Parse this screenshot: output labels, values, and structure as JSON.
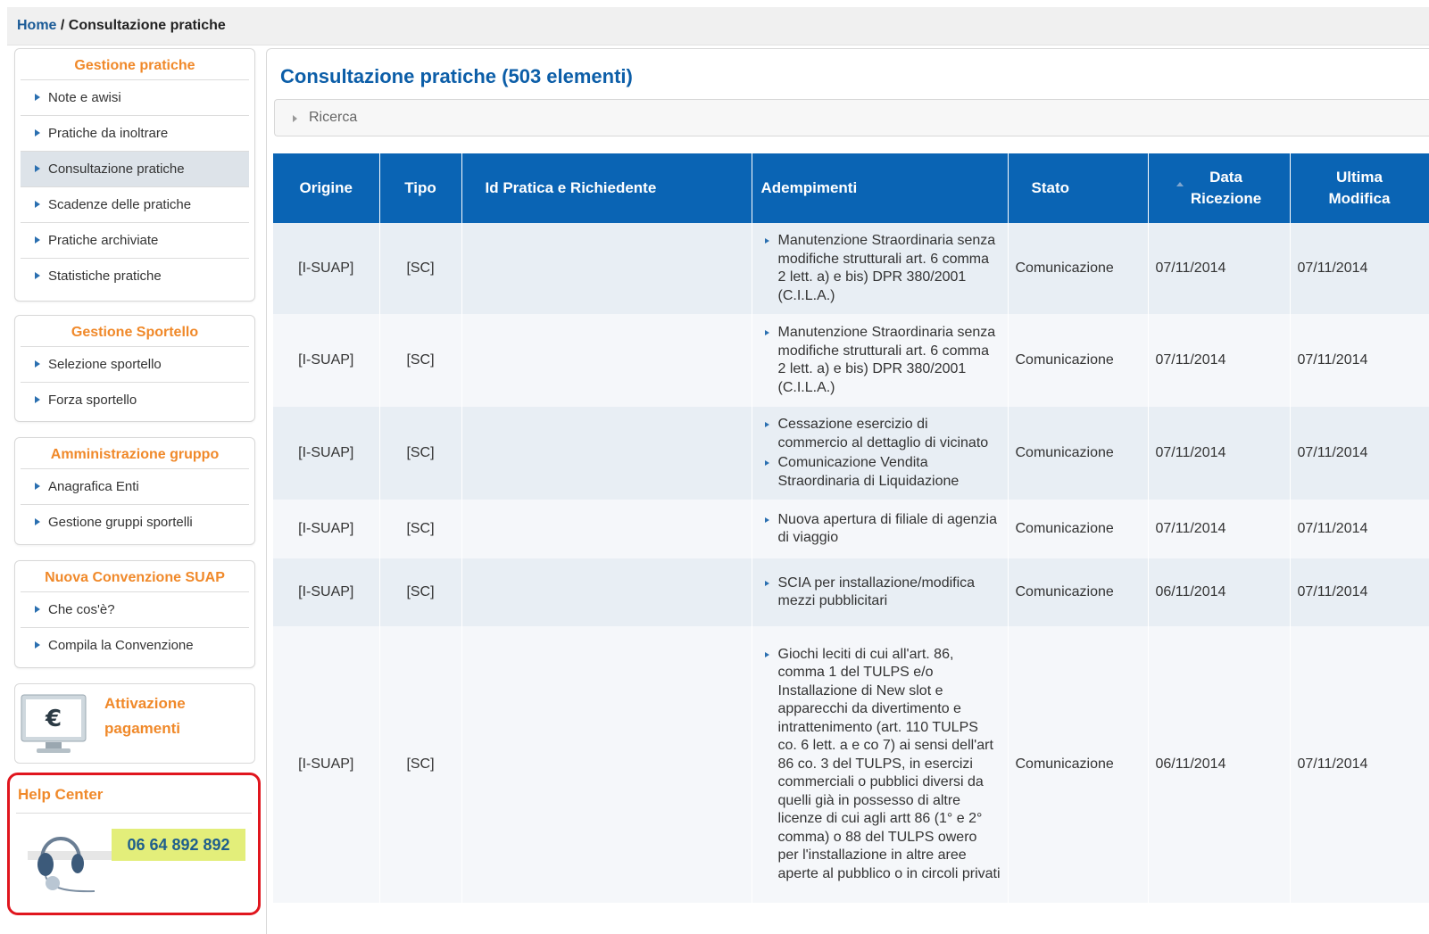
{
  "breadcrumb": {
    "home": "Home",
    "separator": " / ",
    "current": "Consultazione pratiche"
  },
  "sidebar": {
    "gestione_pratiche": {
      "title": "Gestione pratiche",
      "items": [
        {
          "label": "Note e awisi"
        },
        {
          "label": "Pratiche da inoltrare"
        },
        {
          "label": "Consultazione pratiche"
        },
        {
          "label": "Scadenze delle pratiche"
        },
        {
          "label": "Pratiche archiviate"
        },
        {
          "label": "Statistiche pratiche"
        }
      ]
    },
    "gestione_sportello": {
      "title": "Gestione Sportello",
      "items": [
        {
          "label": "Selezione sportello"
        },
        {
          "label": "Forza sportello"
        }
      ]
    },
    "amministrazione_gruppo": {
      "title": "Amministrazione gruppo",
      "items": [
        {
          "label": "Anagrafica Enti"
        },
        {
          "label": "Gestione gruppi sportelli"
        }
      ]
    },
    "nuova_convenzione": {
      "title": "Nuova Convenzione SUAP",
      "items": [
        {
          "label": "Che cos'è?"
        },
        {
          "label": "Compila la Convenzione"
        }
      ]
    },
    "payments": {
      "label_line1": "Attivazione",
      "label_line2": "pagamenti",
      "icon": "euro-monitor-icon",
      "symbol": "€"
    },
    "help": {
      "title": "Help Center",
      "phone": "06 64 892 892",
      "icon": "headset-icon"
    }
  },
  "main": {
    "title": "Consultazione pratiche (503 elementi)",
    "search_label": "Ricerca",
    "columns": {
      "origine": "Origine",
      "tipo": "Tipo",
      "id": "Id Pratica e Richiedente",
      "adempimenti": "Adempimenti",
      "stato": "Stato",
      "data_ricezione_1": "Data",
      "data_ricezione_2": "Ricezione",
      "ultima_modifica_1": "Ultima",
      "ultima_modifica_2": "Modifica"
    },
    "rows": [
      {
        "origine": "[I-SUAP]",
        "tipo": "[SC]",
        "id": "",
        "adempimenti": [
          "Manutenzione Straordinaria senza modifiche strutturali art. 6 comma 2 lett. a) e bis) DPR 380/2001 (C.I.L.A.)"
        ],
        "stato": "Comunicazione",
        "data_ricezione": "07/11/2014",
        "ultima_modifica": "07/11/2014"
      },
      {
        "origine": "[I-SUAP]",
        "tipo": "[SC]",
        "id": "",
        "adempimenti": [
          "Manutenzione Straordinaria senza modifiche strutturali art. 6 comma 2 lett. a) e bis) DPR 380/2001 (C.I.L.A.)"
        ],
        "stato": "Comunicazione",
        "data_ricezione": "07/11/2014",
        "ultima_modifica": "07/11/2014"
      },
      {
        "origine": "[I-SUAP]",
        "tipo": "[SC]",
        "id": "",
        "adempimenti": [
          "Cessazione esercizio di commercio al dettaglio di vicinato",
          "Comunicazione Vendita Straordinaria di Liquidazione"
        ],
        "stato": "Comunicazione",
        "data_ricezione": "07/11/2014",
        "ultima_modifica": "07/11/2014"
      },
      {
        "origine": "[I-SUAP]",
        "tipo": "[SC]",
        "id": "",
        "adempimenti": [
          "Nuova apertura di filiale di agenzia di viaggio"
        ],
        "stato": "Comunicazione",
        "data_ricezione": "07/11/2014",
        "ultima_modifica": "07/11/2014"
      },
      {
        "origine": "[I-SUAP]",
        "tipo": "[SC]",
        "id": "",
        "adempimenti": [
          "SCIA per installazione/modifica mezzi pubblicitari"
        ],
        "stato": "Comunicazione",
        "data_ricezione": "06/11/2014",
        "ultima_modifica": "07/11/2014"
      },
      {
        "origine": "[I-SUAP]",
        "tipo": "[SC]",
        "id": "",
        "adempimenti": [
          "Giochi leciti di cui all'art. 86, comma 1 del TULPS e/o Installazione di New slot e apparecchi da divertimento e intrattenimento (art. 110 TULPS co. 6 lett. a e co 7) ai sensi dell'art 86 co. 3 del TULPS, in esercizi commerciali o pubblici diversi da quelli già in possesso di altre licenze di cui agli artt 86 (1° e 2° comma) o 88 del TULPS owero per l'installazione in altre aree aperte al pubblico o in circoli privati"
        ],
        "stato": "Comunicazione",
        "data_ricezione": "06/11/2014",
        "ultima_modifica": "07/11/2014"
      }
    ]
  },
  "colors": {
    "accent_blue": "#0a64b4",
    "title_blue": "#0c5ea8",
    "orange": "#f0892a",
    "help_border": "#e0161e",
    "phone_bg": "#e3ee7a"
  }
}
